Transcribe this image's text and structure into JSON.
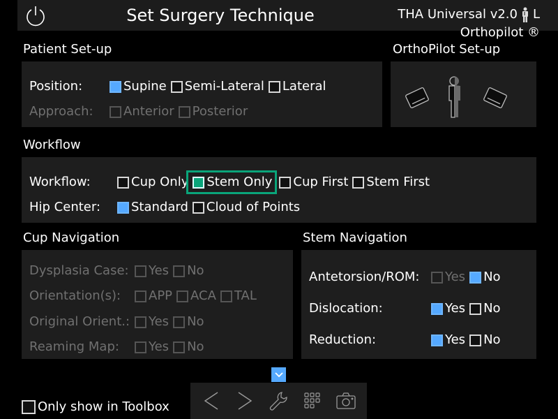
{
  "header": {
    "title": "Set Surgery Technique",
    "product": "THA Universal v2.0",
    "side": "L",
    "brand": "Orthopilot ®",
    "power_icon": "power-icon",
    "patient_icon": "patient-figure-icon"
  },
  "patient_setup": {
    "title": "Patient Set-up",
    "position": {
      "label": "Position:",
      "options": [
        {
          "label": "Supine",
          "checked": true
        },
        {
          "label": "Semi-Lateral",
          "checked": false
        },
        {
          "label": "Lateral",
          "checked": false
        }
      ]
    },
    "approach": {
      "label": "Approach:",
      "disabled": true,
      "options": [
        {
          "label": "Anterior",
          "checked": false
        },
        {
          "label": "Posterior",
          "checked": false
        }
      ]
    }
  },
  "orthopilot_setup": {
    "title": "OrthoPilot Set-up",
    "icons": [
      "camera-left-icon",
      "half-patient-figure-icon",
      "camera-right-icon"
    ]
  },
  "workflow": {
    "title": "Workflow",
    "workflow": {
      "label": "Workflow:",
      "options": [
        {
          "label": "Cup Only",
          "checked": false
        },
        {
          "label": "Stem Only",
          "checked": true,
          "highlighted": true
        },
        {
          "label": "Cup First",
          "checked": false
        },
        {
          "label": "Stem First",
          "checked": false
        }
      ]
    },
    "hip_center": {
      "label": "Hip Center:",
      "options": [
        {
          "label": "Standard",
          "checked": true
        },
        {
          "label": "Cloud of Points",
          "checked": false
        }
      ]
    }
  },
  "cup_navigation": {
    "title": "Cup Navigation",
    "disabled": true,
    "rows": [
      {
        "label": "Dysplasia Case:",
        "options": [
          {
            "label": "Yes",
            "checked": false
          },
          {
            "label": "No",
            "checked": false
          }
        ]
      },
      {
        "label": "Orientation(s):",
        "options": [
          {
            "label": "APP",
            "checked": false
          },
          {
            "label": "ACA",
            "checked": false
          },
          {
            "label": "TAL",
            "checked": false
          }
        ]
      },
      {
        "label": "Original Orient.:",
        "options": [
          {
            "label": "Yes",
            "checked": false
          },
          {
            "label": "No",
            "checked": false
          }
        ]
      },
      {
        "label": "Reaming Map:",
        "options": [
          {
            "label": "Yes",
            "checked": false
          },
          {
            "label": "No",
            "checked": false
          }
        ]
      }
    ]
  },
  "stem_navigation": {
    "title": "Stem Navigation",
    "rows": [
      {
        "label": "Antetorsion/ROM:",
        "options": [
          {
            "label": "Yes",
            "checked": false,
            "disabled": true
          },
          {
            "label": "No",
            "checked": true
          }
        ]
      },
      {
        "label": "Dislocation:",
        "options": [
          {
            "label": "Yes",
            "checked": true
          },
          {
            "label": "No",
            "checked": false
          }
        ]
      },
      {
        "label": "Reduction:",
        "options": [
          {
            "label": "Yes",
            "checked": true
          },
          {
            "label": "No",
            "checked": false
          }
        ]
      }
    ]
  },
  "footer": {
    "toolbox_only": {
      "label": "Only show in Toolbox",
      "checked": false
    },
    "collapse_icon": "chevron-down-icon",
    "toolbar": [
      "back-icon",
      "forward-icon",
      "wrench-icon",
      "grid-icon",
      "camera-icon"
    ]
  },
  "colors": {
    "checked": "#55a9ff",
    "highlight": "#0aa57a",
    "panel": "#1e1e1e",
    "disabled_text": "#707070"
  }
}
